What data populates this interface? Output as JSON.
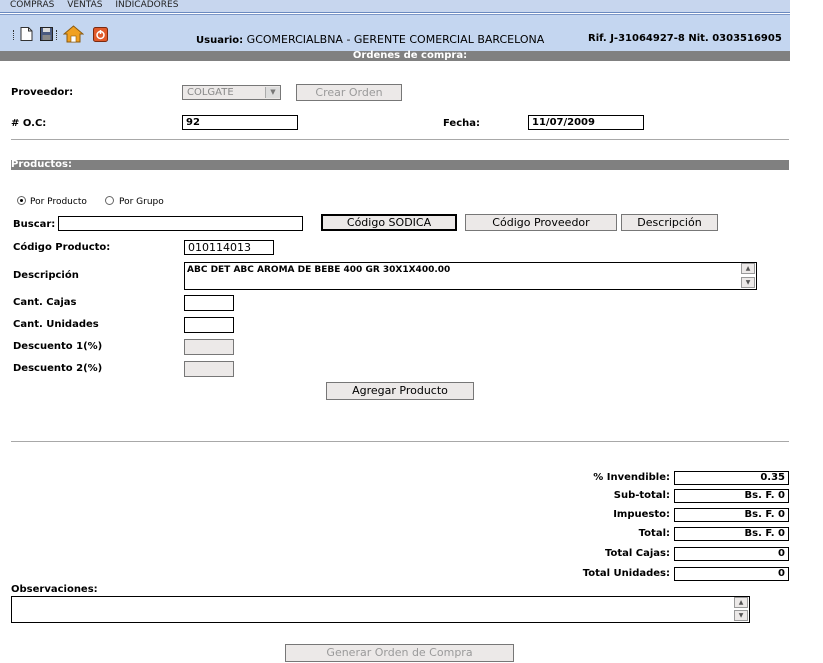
{
  "top_menu": [
    "COMPRAS",
    "VENTAS",
    "INDICADORES"
  ],
  "header": {
    "user_label": "Usuario:",
    "user_value": "GCOMERCIALBNA - GERENTE COMERCIAL BARCELONA",
    "rif": "Rif. J-31064927-8  Nit. 0303516905"
  },
  "page_title": "Ordenes de compra:",
  "proveedor": {
    "label": "Proveedor:",
    "selected": "COLGATE",
    "crear_label": "Crear Orden"
  },
  "oc": {
    "label": "# O.C:",
    "value": "92"
  },
  "fecha": {
    "label": "Fecha:",
    "value": "11/07/2009"
  },
  "productos_title": "Productos:",
  "search_mode": {
    "por_producto": "Por Producto",
    "por_grupo": "Por Grupo",
    "selected": "por_producto"
  },
  "buscar": {
    "label": "Buscar:",
    "value": ""
  },
  "search_buttons": {
    "codigo_sodica": "Código SODICA",
    "codigo_proveedor": "Código Proveedor",
    "descripcion": "Descripción"
  },
  "codigo_producto": {
    "label": "Código Producto:",
    "value": "010114013"
  },
  "descripcion": {
    "label": "Descripción",
    "value": "ABC DET ABC AROMA DE BEBE 400 GR 30X1X400.00"
  },
  "cant_cajas": {
    "label": "Cant. Cajas",
    "value": ""
  },
  "cant_unidades": {
    "label": "Cant. Unidades",
    "value": ""
  },
  "descuento1": {
    "label": "Descuento 1(%)",
    "value": ""
  },
  "descuento2": {
    "label": "Descuento 2(%)",
    "value": ""
  },
  "agregar_label": "Agregar Producto",
  "totals": {
    "invendible": {
      "label": "% Invendible:",
      "value": "0.35"
    },
    "subtotal": {
      "label": "Sub-total:",
      "value": "Bs. F. 0"
    },
    "impuesto": {
      "label": "Impuesto:",
      "value": "Bs. F. 0"
    },
    "total": {
      "label": "Total:",
      "value": "Bs. F. 0"
    },
    "total_cajas": {
      "label": "Total Cajas:",
      "value": "0"
    },
    "total_unidades": {
      "label": "Total Unidades:",
      "value": "0"
    }
  },
  "observaciones": {
    "label": "Observaciones:",
    "value": ""
  },
  "generar_label": "Generar Orden de Compra",
  "colors": {
    "header_bg": "#c4d6f0",
    "section_bar": "#808080",
    "button_bg": "#ece9e8",
    "home_orange": "#f0a020",
    "power_red": "#e05a2a"
  }
}
